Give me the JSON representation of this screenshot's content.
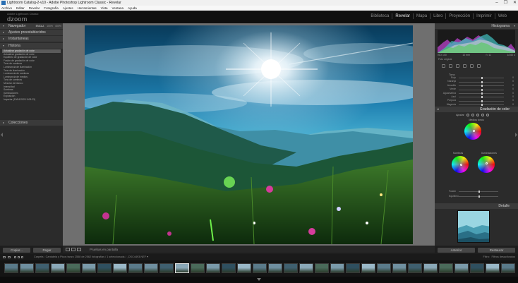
{
  "window": {
    "title": "Lightroom Catalog-2-v10 - Adobe Photoshop Lightroom Classic - Revelar",
    "controls": [
      "–",
      "❐",
      "✕"
    ]
  },
  "menu": [
    "Archivo",
    "Editar",
    "Revelar",
    "Fotografía",
    "Ajustes",
    "Herramientas",
    "Vista",
    "Ventana",
    "Ayuda"
  ],
  "identity": {
    "small": "Adobe Lightroom Classic",
    "brand": "dzoom"
  },
  "modules": {
    "items": [
      "Biblioteca",
      "Revelar",
      "Mapa",
      "Libro",
      "Proyección",
      "Imprimir",
      "Web"
    ],
    "active": "Revelar"
  },
  "left_panel": {
    "navigator": {
      "label": "Navegador",
      "zoom": [
        "ENCAJ.",
        "100%",
        "400%"
      ]
    },
    "presets": {
      "label": "Ajustes preestablecidos"
    },
    "snapshots": {
      "label": "Instantáneas"
    },
    "history": {
      "label": "Historia",
      "items": [
        {
          "label": "Actualizar gradación de color",
          "value": "",
          "selected": true
        },
        {
          "label": "Actualizar gradación de color",
          "value": ""
        },
        {
          "label": "Equilibrio de gradación de color",
          "value": ""
        },
        {
          "label": "Fusión de gradación de color",
          "value": ""
        },
        {
          "label": "Tono de sombras",
          "value": ""
        },
        {
          "label": "Luminancia de iluminación",
          "value": ""
        },
        {
          "label": "Tono de iluminación",
          "value": ""
        },
        {
          "label": "Luminancia de sombras",
          "value": ""
        },
        {
          "label": "Luminancia de medios",
          "value": ""
        },
        {
          "label": "Tono de sombras",
          "value": ""
        },
        {
          "label": "Mezclar de blanco",
          "value": ""
        },
        {
          "label": "Intensidad",
          "value": ""
        },
        {
          "label": "Sombras",
          "value": ""
        },
        {
          "label": "Iluminaciones",
          "value": ""
        },
        {
          "label": "Exposición",
          "value": ""
        },
        {
          "label": "Importar (19/04/2020 9:08:23)",
          "value": ""
        }
      ]
    },
    "collections": {
      "label": "Colecciones"
    },
    "buttons": {
      "copy": "Copiar...",
      "paste": "Pegar"
    }
  },
  "toolbar": {
    "label": "Pruebas en pantalla"
  },
  "right_panel": {
    "histogram": {
      "label": "Histograma",
      "info_left": "ISO 100",
      "info_mid1": "10 mm",
      "info_mid2": "f / 11",
      "info_right": "1/160 s",
      "original": "Foto original"
    },
    "hsl": {
      "title": "Tono",
      "rows": [
        {
          "label": "Rojo",
          "value": "0",
          "pos": 0.5
        },
        {
          "label": "Naranja",
          "value": "0",
          "pos": 0.5
        },
        {
          "label": "Amarillo",
          "value": "0",
          "pos": 0.5
        },
        {
          "label": "Verde",
          "value": "0",
          "pos": 0.5
        },
        {
          "label": "Aguamarina",
          "value": "0",
          "pos": 0.5
        },
        {
          "label": "Azul",
          "value": "0",
          "pos": 0.5
        },
        {
          "label": "Púrpura",
          "value": "0",
          "pos": 0.5
        },
        {
          "label": "Magenta",
          "value": "0",
          "pos": 0.5
        }
      ]
    },
    "color_grading": {
      "label": "Gradación de color",
      "adjust": "Ajustar",
      "midtones": "Medios tonos",
      "shadows": "Sombras",
      "highlights": "Iluminaciones",
      "blending": "Fusión",
      "balance": "Equilibrio"
    },
    "detail": {
      "label": "Detalle"
    },
    "buttons": {
      "previous": "Anterior",
      "reset": "Restaurar"
    }
  },
  "filmstrip": {
    "info": "Carpeta : Cantabria y Picos tanzo    2558 de 2562 fotografías / 1 seleccionada /    _DSC4493.NEF ▾",
    "filter_label": "Filtro:",
    "filter_value": "Filtros desactivados",
    "thumb_count": 33,
    "selected_index": 11
  },
  "colors": {
    "panel_bg": "#2b2b2b",
    "header_bg": "#3a3a3a",
    "view_bg": "#6f6f6f",
    "sky_top": "#0a3d5c",
    "sky_mid": "#2f9cc2"
  }
}
